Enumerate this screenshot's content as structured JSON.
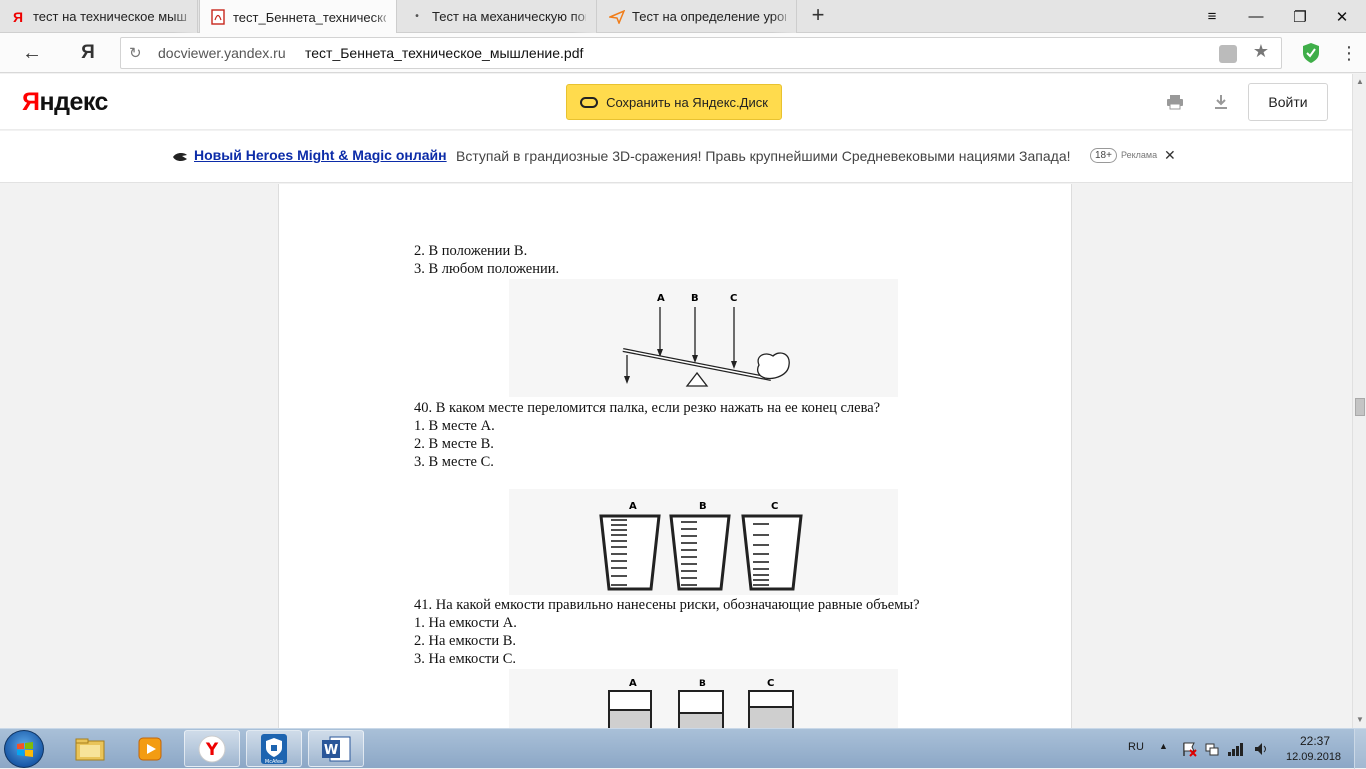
{
  "browser": {
    "tabs": [
      {
        "title": "тест на техническое мышление",
        "icon": "yandex-favicon",
        "active": false
      },
      {
        "title": "тест_Беннета_техническое_мышление.pdf",
        "icon": "pdf-favicon",
        "active": true
      },
      {
        "title": "Тест на механическую понятливость",
        "icon": "dot-favicon",
        "active": false
      },
      {
        "title": "Тест на определение уровня",
        "icon": "paper-plane-favicon",
        "active": false
      }
    ],
    "new_tab": "+",
    "window_controls": {
      "menu": "≡",
      "minimize": "—",
      "restore": "❐",
      "close": "✕"
    },
    "nav": {
      "back": "←",
      "yandex": "Я",
      "reload": "↻"
    },
    "address": {
      "host": "docviewer.yandex.ru",
      "path": "тест_Беннета_техническое_мышление.pdf"
    }
  },
  "viewer": {
    "logo_red": "Я",
    "logo_rest": "ндекс",
    "save_button": "Сохранить на Яндекс.Диск",
    "login_button": "Войти"
  },
  "ad": {
    "title": "Новый Heroes Might & Magic онлайн",
    "text": "Вступай в грандиозные 3D-сражения! Правь крупнейшими Средневековыми нациями Запада!",
    "age": "18+",
    "label": "Реклама",
    "close": "✕"
  },
  "document": {
    "lines_top": [
      "2. В положении В.",
      "3. В любом положении."
    ],
    "fig1": {
      "labels": [
        "A",
        "B",
        "C"
      ]
    },
    "q40": {
      "question": "40. В каком месте переломится палка, если резко нажать на ее конец слева?",
      "options": [
        "1. В месте А.",
        "2. В месте В.",
        "3. В месте С."
      ]
    },
    "fig2": {
      "labels": [
        "A",
        "B",
        "C"
      ]
    },
    "q41": {
      "question": "41. На какой емкости правильно нанесены риски, обозначающие равные объемы?",
      "options": [
        "1. На емкости А.",
        "2. На емкости В.",
        "3. На емкости С."
      ]
    },
    "fig3": {
      "labels": [
        "A",
        "B",
        "C"
      ]
    }
  },
  "taskbar": {
    "apps": [
      "explorer-icon",
      "media-player-icon",
      "yandex-browser-icon",
      "mcafee-icon",
      "word-icon"
    ],
    "mcafee_caption": "McAfee",
    "lang": "RU",
    "time": "22:37",
    "date": "12.09.2018"
  }
}
